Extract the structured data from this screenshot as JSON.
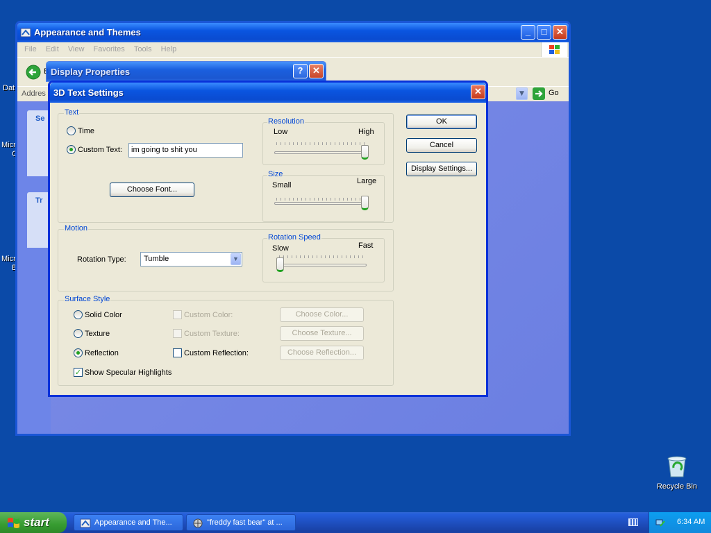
{
  "desktop": {
    "left_labels": [
      "Dat",
      "Micro",
      "C",
      "Micro",
      "B"
    ],
    "recycle_bin_label": "Recycle Bin"
  },
  "explorer": {
    "title": "Appearance and Themes",
    "menu": [
      "File",
      "Edit",
      "View",
      "Favorites",
      "Tools",
      "Help"
    ],
    "back_label": "B",
    "address_label": "Addres",
    "go_label": "Go",
    "left_pane": {
      "box1_title": "Se",
      "box2_title": "Tr"
    }
  },
  "display_properties": {
    "title": "Display Properties"
  },
  "dialog": {
    "title": "3D Text Settings",
    "text_group": {
      "legend": "Text",
      "time_label": "Time",
      "custom_text_label": "Custom Text:",
      "custom_text_value": "im going to shit you",
      "selected": "custom_text",
      "choose_font_label": "Choose Font..."
    },
    "resolution": {
      "legend": "Resolution",
      "low_label": "Low",
      "high_label": "High",
      "value": 1.0
    },
    "size": {
      "legend": "Size",
      "small_label": "Small",
      "large_label": "Large",
      "value": 1.0
    },
    "motion": {
      "legend": "Motion",
      "rotation_type_label": "Rotation Type:",
      "rotation_type_value": "Tumble"
    },
    "rotation_speed": {
      "legend": "Rotation Speed",
      "slow_label": "Slow",
      "fast_label": "Fast",
      "value": 0.0
    },
    "surface": {
      "legend": "Surface Style",
      "solid_color_label": "Solid Color",
      "texture_label": "Texture",
      "reflection_label": "Reflection",
      "selected": "reflection",
      "custom_color_label": "Custom Color:",
      "custom_texture_label": "Custom Texture:",
      "custom_reflection_label": "Custom Reflection:",
      "choose_color_label": "Choose Color...",
      "choose_texture_label": "Choose Texture...",
      "choose_reflection_label": "Choose Reflection...",
      "specular_label": "Show Specular Highlights",
      "specular_checked": true
    },
    "buttons": {
      "ok": "OK",
      "cancel": "Cancel",
      "display_settings": "Display Settings..."
    }
  },
  "taskbar": {
    "start_label": "start",
    "tasks": [
      "Appearance and The...",
      "\"freddy fast bear\" at ..."
    ],
    "clock": "6:34 AM"
  }
}
